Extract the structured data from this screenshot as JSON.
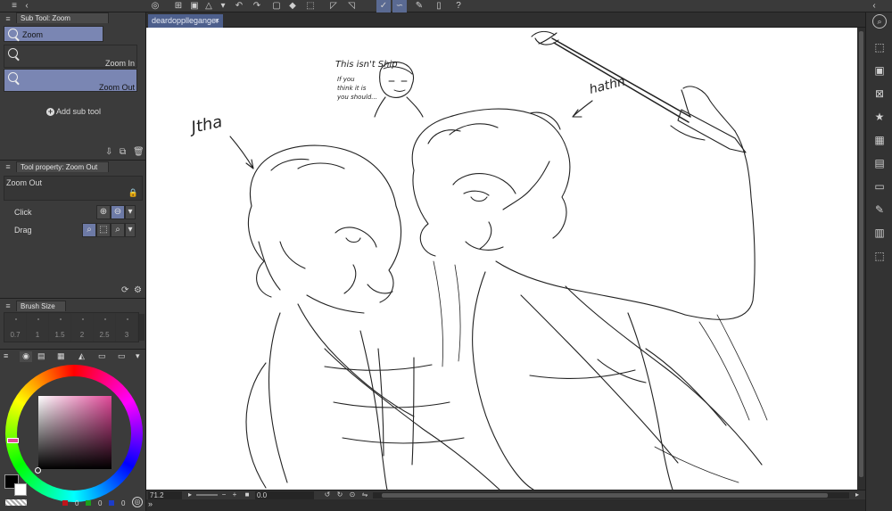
{
  "document": {
    "tab_title": "deardopplleganger",
    "close_glyph": "×"
  },
  "subtool_panel": {
    "tab_label": "Sub Tool: Zoom",
    "search_value": "Zoom",
    "items": [
      {
        "label": "Zoom In"
      },
      {
        "label": "Zoom Out"
      }
    ],
    "add_label": "Add sub tool"
  },
  "tool_property": {
    "tab_label": "Tool property: Zoom Out",
    "title": "Zoom Out",
    "rows": [
      {
        "label": "Click"
      },
      {
        "label": "Drag"
      }
    ]
  },
  "brush_size": {
    "tab_label": "Brush Size",
    "sizes": [
      "0.7",
      "1",
      "1.5",
      "2",
      "2.5",
      "3"
    ]
  },
  "status_bar": {
    "zoom_value": "71.2",
    "angle_value": "0.0"
  },
  "color": {
    "main": "#000000",
    "sub": "#ffffff",
    "hue_accent": "#e04898",
    "rgb_r": "0",
    "rgb_g": "0",
    "rgb_b": "0"
  },
  "sketch_text": {
    "label_left": "Jtha",
    "label_right": "hathn",
    "note_line1": "This isn't Ship",
    "note_line2": "If you",
    "note_line3": "think it is",
    "note_line4": "you should..."
  }
}
